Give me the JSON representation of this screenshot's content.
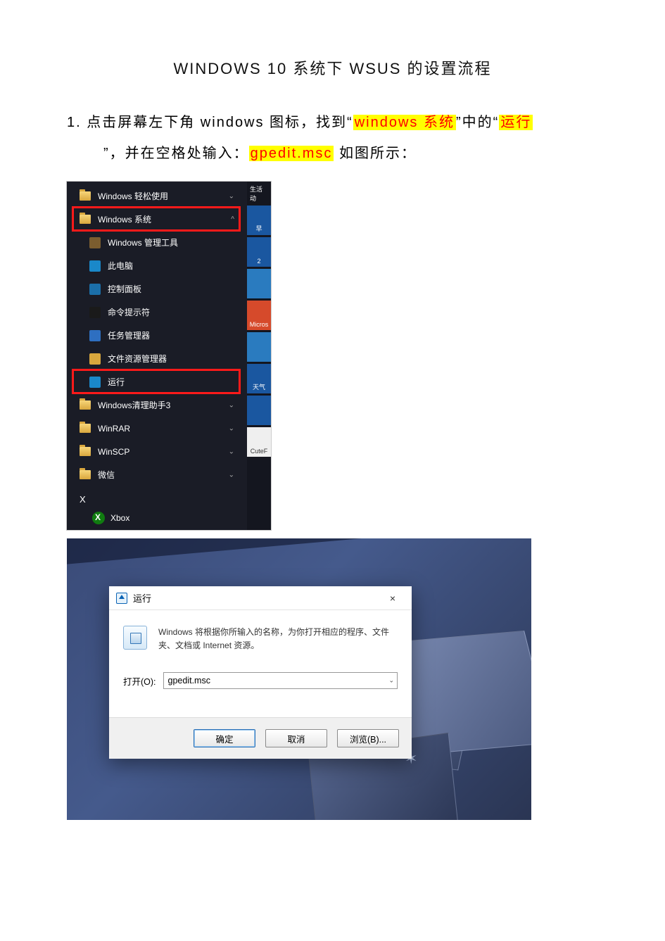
{
  "doc": {
    "title": "WINDOWS 10 系统下 WSUS 的设置流程",
    "step_no": "1.",
    "step_pre": "点击屏幕左下角 windows 图标，找到“",
    "hl1": "windows 系统",
    "step_mid1": "”中的“",
    "hl2": "运行",
    "step_mid2": "”，并在空格处输入：",
    "hl3": "gpedit.msc",
    "step_post": " 如图所示："
  },
  "startMenu": {
    "tileHeader": "生活动",
    "items": [
      {
        "label": "Windows 轻松使用",
        "type": "folder",
        "chev": "⌄"
      },
      {
        "label": "Windows 系统",
        "type": "folder",
        "chev": "^",
        "highlighted": true
      },
      {
        "label": "Windows 管理工具",
        "type": "sub",
        "iconBg": "#7b5d2f"
      },
      {
        "label": "此电脑",
        "type": "sub",
        "iconBg": "#1a88c9"
      },
      {
        "label": "控制面板",
        "type": "sub",
        "iconBg": "#1b6fa9"
      },
      {
        "label": "命令提示符",
        "type": "sub",
        "iconBg": "#1a1a1a"
      },
      {
        "label": "任务管理器",
        "type": "sub",
        "iconBg": "#2e6fc1"
      },
      {
        "label": "文件资源管理器",
        "type": "sub",
        "iconBg": "#d9a73d"
      },
      {
        "label": "运行",
        "type": "sub",
        "iconBg": "#1a88c9",
        "highlighted": true
      },
      {
        "label": "Windows清理助手3",
        "type": "folder",
        "chev": "⌄"
      },
      {
        "label": "WinRAR",
        "type": "folder",
        "chev": "⌄"
      },
      {
        "label": "WinSCP",
        "type": "folder",
        "chev": "⌄"
      },
      {
        "label": "微信",
        "type": "folder",
        "chev": "⌄"
      }
    ],
    "letter": "X",
    "xbox": "Xbox",
    "tiles": [
      {
        "label": "早",
        "bg": "#1a57a0"
      },
      {
        "label": "2",
        "bg": "#1a57a0"
      },
      {
        "label": "",
        "bg": "#2a7bbf"
      },
      {
        "label": "Micros",
        "bg": "#d64a2b"
      },
      {
        "label": "",
        "bg": "#2a7bbf"
      },
      {
        "label": "天气",
        "bg": "#1a57a0"
      },
      {
        "label": "",
        "bg": "#1a57a0"
      },
      {
        "label": "CuteF",
        "bg": "#efefef"
      }
    ]
  },
  "runDialog": {
    "title": "运行",
    "close": "×",
    "desc": "Windows 将根据你所输入的名称，为你打开相应的程序、文件夹、文档或 Internet 资源。",
    "openLabel": "打开(O):",
    "value": "gpedit.msc",
    "btnOk": "确定",
    "btnCancel": "取消",
    "btnBrowse": "浏览(B)..."
  }
}
